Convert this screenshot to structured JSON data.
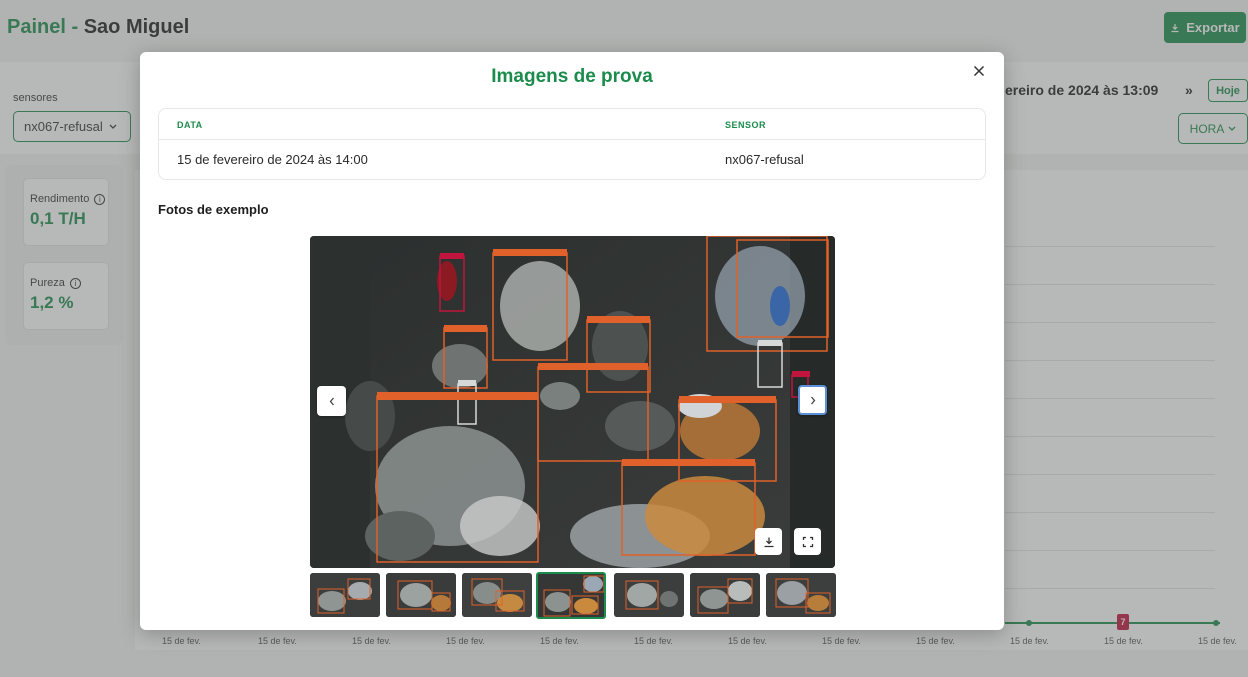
{
  "background": {
    "title_brand": "Painel -",
    "title_site": "Sao Miguel",
    "export_label": "Exportar",
    "sensores_label": "sensores",
    "sensor_selected": "nx067-refusal",
    "date_range_text": "ereiro de 2024 às 13:09",
    "today_label": "Hoje",
    "granularity_selected": "HORA",
    "cards": [
      {
        "label": "Rendimento",
        "value": "0,1 T/H"
      },
      {
        "label": "Pureza",
        "value": "1,2 %"
      }
    ],
    "x_ticks": [
      "15 de fev.",
      "15 de fev.",
      "15 de fev.",
      "15 de fev.",
      "15 de fev.",
      "15 de fev.",
      "15 de fev.",
      "15 de fev.",
      "15 de fev.",
      "15 de fev.",
      "15 de fev.",
      "15 de fev."
    ],
    "chart_marker_label": "7"
  },
  "modal": {
    "title": "Imagens de prova",
    "table": {
      "headers": {
        "date": "DATA",
        "sensor": "SENSOR"
      },
      "row": {
        "date": "15 de fevereiro de 2024 às 14:00",
        "sensor": "nx067-refusal"
      }
    },
    "section_title": "Fotos de exemplo",
    "thumbnail_count": 7,
    "active_thumbnail": 4
  },
  "colors": {
    "brand_green": "#1b8c4b",
    "detection_box": "#e0612a",
    "alert_red": "#c0153d"
  },
  "icons": {
    "close": "close-icon",
    "prev": "chevron-left-icon",
    "next": "chevron-right-icon",
    "download": "download-icon",
    "fullscreen": "fullscreen-icon",
    "info": "info-icon",
    "chevron_down": "chevron-down-icon"
  }
}
